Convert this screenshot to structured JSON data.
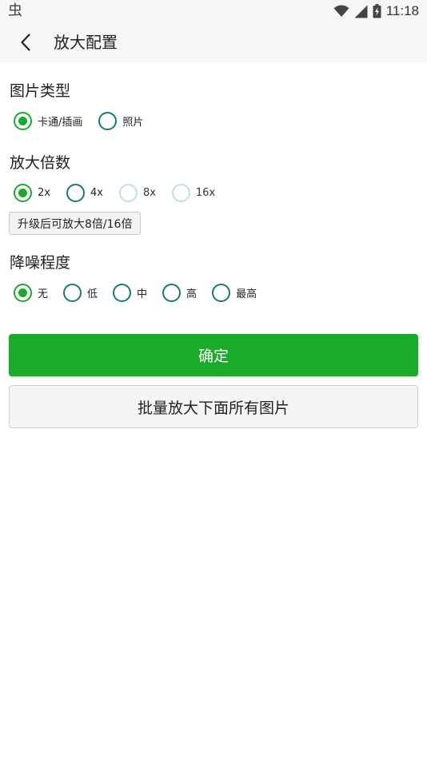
{
  "status_bar": {
    "left_icon": "bug-icon",
    "left_glyph": "虫",
    "time": "11:18",
    "icons": [
      "wifi-icon",
      "signal-icon",
      "battery-charging-icon"
    ]
  },
  "app_bar": {
    "back_icon": "chevron-left-icon",
    "title": "放大配置"
  },
  "image_type": {
    "title": "图片类型",
    "options": [
      {
        "label": "卡通/插画",
        "checked": true,
        "enabled": true
      },
      {
        "label": "照片",
        "checked": false,
        "enabled": true
      }
    ]
  },
  "scale": {
    "title": "放大倍数",
    "options": [
      {
        "label": "2x",
        "checked": true,
        "enabled": true
      },
      {
        "label": "4x",
        "checked": false,
        "enabled": true
      },
      {
        "label": "8x",
        "checked": false,
        "enabled": false
      },
      {
        "label": "16x",
        "checked": false,
        "enabled": false
      }
    ],
    "upgrade_label": "升级后可放大8倍/16倍"
  },
  "denoise": {
    "title": "降噪程度",
    "options": [
      {
        "label": "无",
        "checked": true,
        "enabled": true
      },
      {
        "label": "低",
        "checked": false,
        "enabled": true
      },
      {
        "label": "中",
        "checked": false,
        "enabled": true
      },
      {
        "label": "高",
        "checked": false,
        "enabled": true
      },
      {
        "label": "最高",
        "checked": false,
        "enabled": true
      }
    ]
  },
  "actions": {
    "confirm_label": "确定",
    "batch_label": "批量放大下面所有图片"
  },
  "colors": {
    "accent": "#1aab2a",
    "radio_border": "#1a7a6e",
    "radio_disabled": "#bfe2dc"
  }
}
